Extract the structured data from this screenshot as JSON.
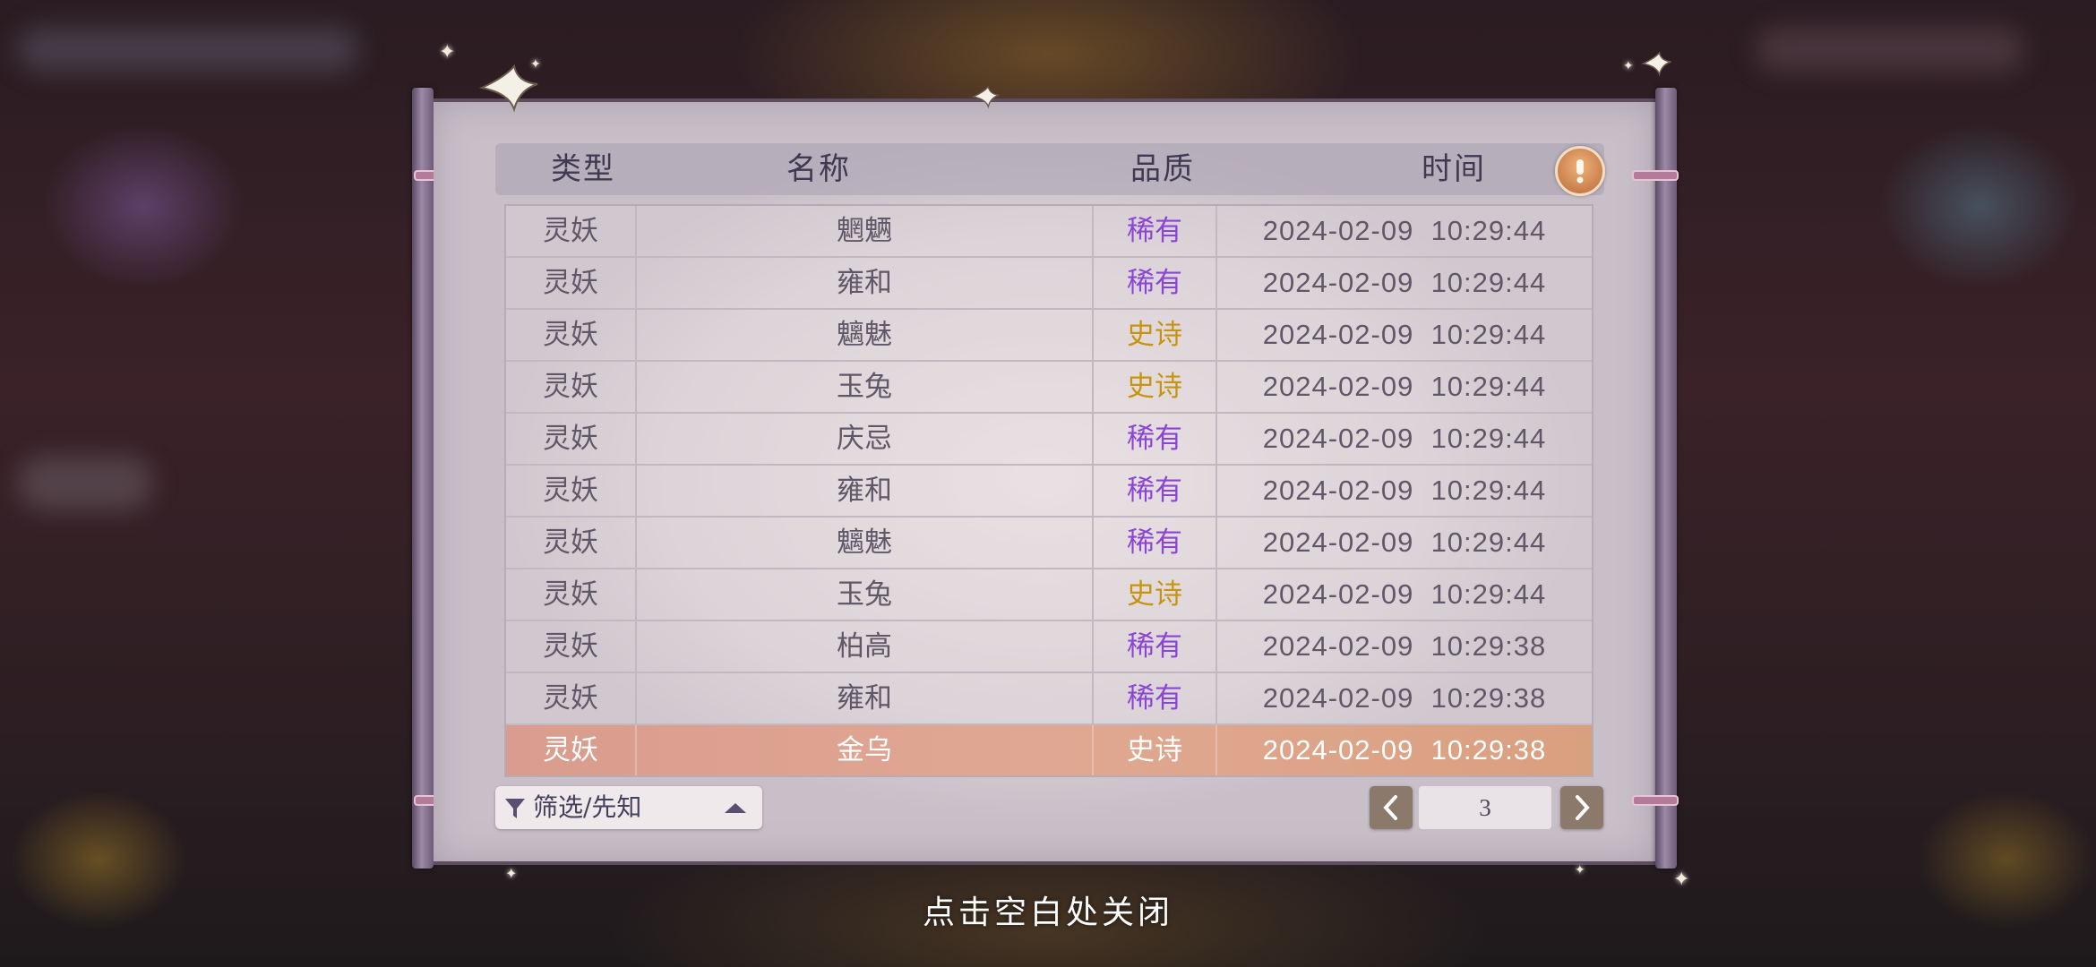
{
  "header": {
    "col_type": "类型",
    "col_name": "名称",
    "col_quality": "品质",
    "col_time": "时间"
  },
  "rows": [
    {
      "type": "灵妖",
      "name": "魍魉",
      "quality": "稀有",
      "tier": "rare",
      "time": "2024-02-09  10:29:44"
    },
    {
      "type": "灵妖",
      "name": "雍和",
      "quality": "稀有",
      "tier": "rare",
      "time": "2024-02-09  10:29:44"
    },
    {
      "type": "灵妖",
      "name": "魑魅",
      "quality": "史诗",
      "tier": "epic",
      "time": "2024-02-09  10:29:44"
    },
    {
      "type": "灵妖",
      "name": "玉兔",
      "quality": "史诗",
      "tier": "epic",
      "time": "2024-02-09  10:29:44"
    },
    {
      "type": "灵妖",
      "name": "庆忌",
      "quality": "稀有",
      "tier": "rare",
      "time": "2024-02-09  10:29:44"
    },
    {
      "type": "灵妖",
      "name": "雍和",
      "quality": "稀有",
      "tier": "rare",
      "time": "2024-02-09  10:29:44"
    },
    {
      "type": "灵妖",
      "name": "魑魅",
      "quality": "稀有",
      "tier": "rare",
      "time": "2024-02-09  10:29:44"
    },
    {
      "type": "灵妖",
      "name": "玉兔",
      "quality": "史诗",
      "tier": "epic",
      "time": "2024-02-09  10:29:44"
    },
    {
      "type": "灵妖",
      "name": "柏高",
      "quality": "稀有",
      "tier": "rare",
      "time": "2024-02-09  10:29:38"
    },
    {
      "type": "灵妖",
      "name": "雍和",
      "quality": "稀有",
      "tier": "rare",
      "time": "2024-02-09  10:29:38"
    },
    {
      "type": "灵妖",
      "name": "金乌",
      "quality": "史诗",
      "tier": "epic",
      "time": "2024-02-09  10:29:38",
      "selected": true
    }
  ],
  "filter": {
    "label": "筛选/先知",
    "icon": "funnel-icon",
    "caret_icon": "caret-up-icon"
  },
  "pagination": {
    "current_page": "3",
    "prev_icon": "chevron-left-icon",
    "next_icon": "chevron-right-icon"
  },
  "hint_icon": "exclamation-icon",
  "close_hint": "点击空白处关闭",
  "colors": {
    "rare": "#8a45d4",
    "epic": "#c79410",
    "selected_row": "#dba08c"
  }
}
